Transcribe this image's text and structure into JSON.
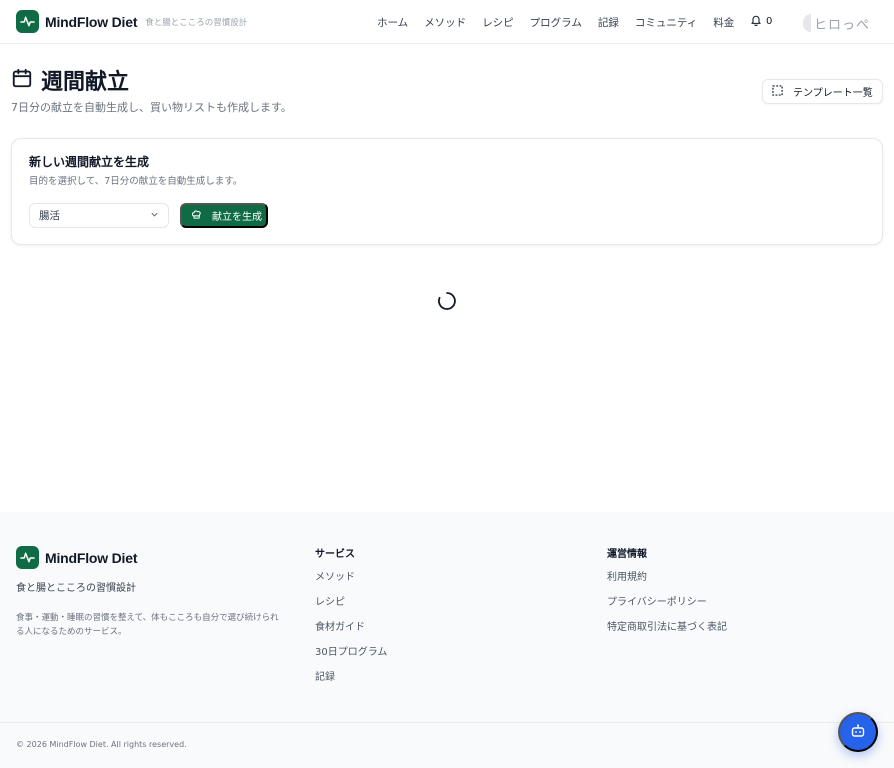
{
  "header": {
    "brand": "MindFlow Diet",
    "tagline": "食と腸とこころの習慣設計",
    "nav": [
      "ホーム",
      "メソッド",
      "レシピ",
      "プログラム",
      "記録",
      "コミュニティ",
      "料金"
    ],
    "notification_count": "0",
    "user_name": "ヒロっぺ"
  },
  "page": {
    "title": "週間献立",
    "subtitle": "7日分の献立を自動生成し、買い物リストも作成します。",
    "template_button": "テンプレート一覧"
  },
  "card": {
    "title": "新しい週間献立を生成",
    "description": "目的を選択して、7日分の献立を自動生成します。",
    "select_value": "腸活",
    "generate_button": "献立を生成"
  },
  "footer": {
    "brand": "MindFlow Diet",
    "tagline": "食と腸とこころの習慣設計",
    "description": "食事・運動・睡眠の習慣を整えて、体もこころも自分で選び続けられる人になるためのサービス。",
    "services_title": "サービス",
    "services": [
      "メソッド",
      "レシピ",
      "食材ガイド",
      "30日プログラム",
      "記録"
    ],
    "info_title": "運営情報",
    "info": [
      "利用規約",
      "プライバシーポリシー",
      "特定商取引法に基づく表記"
    ],
    "copyright": "© 2026 MindFlow Diet. All rights reserved."
  },
  "colors": {
    "brand_green": "#0f6b44",
    "bot_blue": "#2563eb"
  },
  "icons": {
    "logo": "pulse-icon",
    "bell": "bell-icon",
    "calendar": "calendar-icon",
    "template": "dashed-grid-icon",
    "chef": "chef-hat-icon",
    "chevron": "chevron-down-icon",
    "spinner": "loading-spinner",
    "bot": "robot-icon"
  }
}
